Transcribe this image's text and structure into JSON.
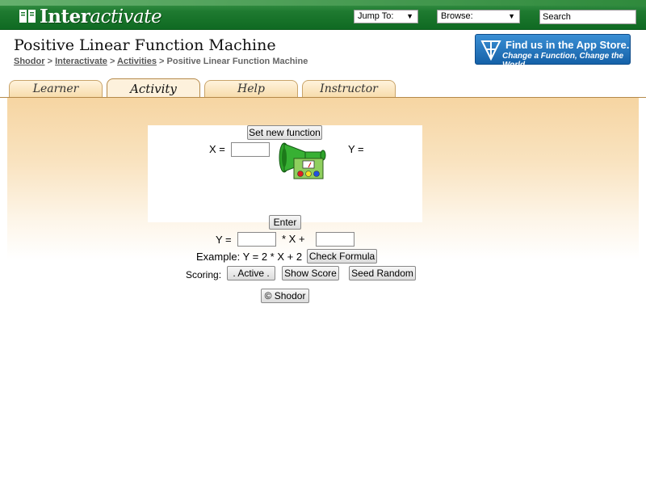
{
  "header": {
    "logo_prefix": "Inter",
    "logo_suffix": "activate",
    "jump_to": "Jump To:",
    "browse": "Browse:",
    "search": "Search"
  },
  "page": {
    "title": "Positive Linear Function Machine",
    "breadcrumb": [
      "Shodor",
      "Interactivate",
      "Activities"
    ],
    "breadcrumb_current": "Positive Linear Function Machine",
    "sep": ">"
  },
  "appstore": {
    "line1": "Find us in the App Store.",
    "line2": "Change a Function, Change the World"
  },
  "tabs": [
    "Learner",
    "Activity",
    "Help",
    "Instructor"
  ],
  "active_tab": "Activity",
  "applet": {
    "set_new_function": "Set new function",
    "x_label": "X =",
    "y_label": "Y =",
    "x_value": "",
    "enter": "Enter",
    "formula_y": "Y =",
    "times_x": "*  X  +",
    "slope_value": "",
    "intercept_value": "",
    "example": "Example: Y = 2 * X + 2",
    "check_formula": "Check Formula",
    "scoring": "Scoring:",
    "active": ".  Active  .",
    "show_score": "Show Score",
    "seed_random": "Seed Random",
    "shodor": "© Shodor"
  },
  "colors": {
    "banner_green": "#1f7a30",
    "tab_orange": "#f7dcac",
    "content_top": "#f6d5a2",
    "machine_green": "#33a02c"
  }
}
